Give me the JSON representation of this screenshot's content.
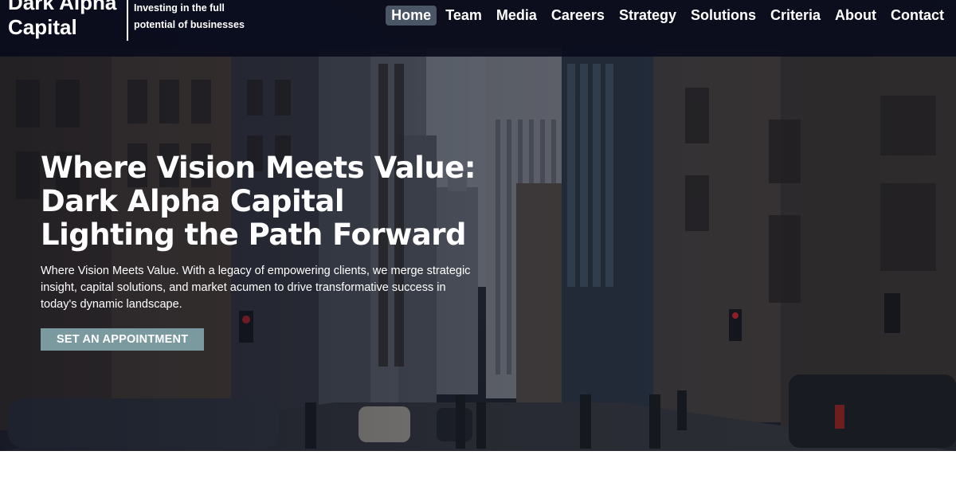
{
  "brand": {
    "name": "Dark Alpha Capital",
    "tagline": "Investing in the full potential of businesses"
  },
  "nav": {
    "items": [
      {
        "label": "Home",
        "active": true
      },
      {
        "label": "Team"
      },
      {
        "label": "Media"
      },
      {
        "label": "Careers"
      },
      {
        "label": "Strategy"
      },
      {
        "label": "Solutions"
      },
      {
        "label": "Criteria"
      },
      {
        "label": "About"
      },
      {
        "label": "Contact"
      }
    ]
  },
  "hero": {
    "title": "Where Vision Meets Value: Dark Alpha Capital Lighting the Path Forward",
    "text": "Where Vision Meets Value. With a legacy of empowering clients, we merge strategic insight, capital solutions, and market acumen to drive transformative success in today's dynamic landscape.",
    "cta_label": "SET AN APPOINTMENT"
  },
  "colors": {
    "header_bg": "#0a0c1c",
    "nav_active_bg": "#4a5566",
    "cta_bg": "#7b9aa0",
    "text": "#ffffff"
  }
}
